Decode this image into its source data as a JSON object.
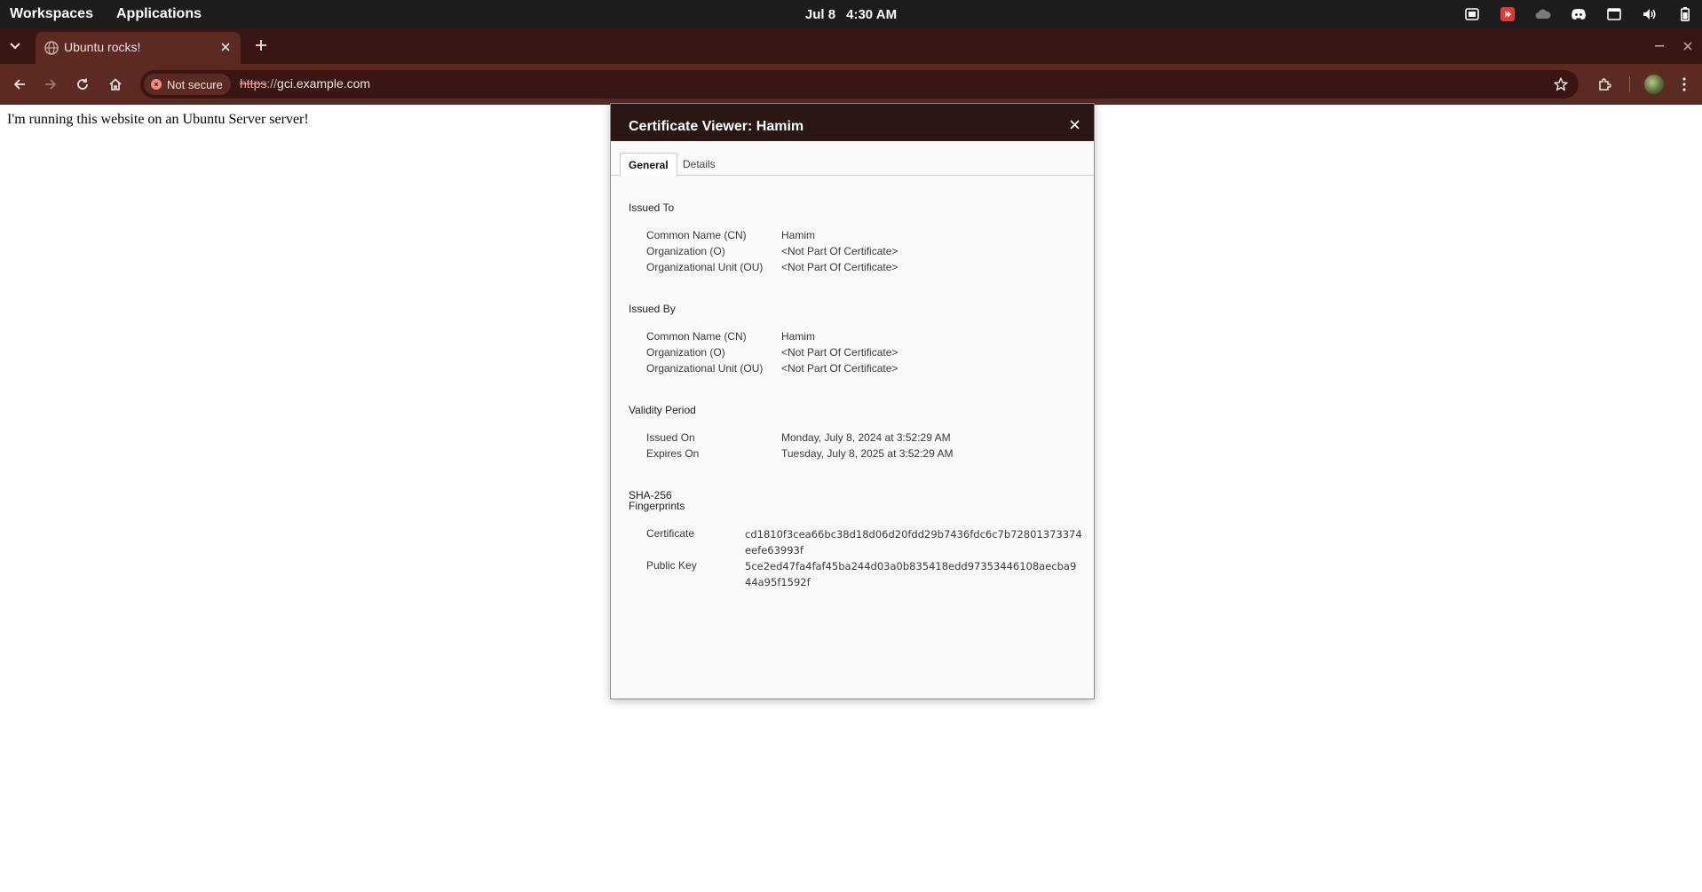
{
  "system_bar": {
    "workspaces": "Workspaces",
    "applications": "Applications",
    "date": "Jul 8",
    "time": "4:30 AM"
  },
  "browser": {
    "tab_title": "Ubuntu rocks!",
    "security_chip": "Not secure",
    "url_scheme": "https",
    "url_separator": "://",
    "url_host": "gci.example.com"
  },
  "page": {
    "text": "I'm running this website on an Ubuntu Server server!"
  },
  "dialog": {
    "title": "Certificate Viewer: Hamim",
    "tabs": [
      "General",
      "Details"
    ],
    "issued_to": {
      "heading": "Issued To",
      "rows": [
        {
          "label": "Common Name (CN)",
          "value": "Hamim"
        },
        {
          "label": "Organization (O)",
          "value": "<Not Part Of Certificate>"
        },
        {
          "label": "Organizational Unit (OU)",
          "value": "<Not Part Of Certificate>"
        }
      ]
    },
    "issued_by": {
      "heading": "Issued By",
      "rows": [
        {
          "label": "Common Name (CN)",
          "value": "Hamim"
        },
        {
          "label": "Organization (O)",
          "value": "<Not Part Of Certificate>"
        },
        {
          "label": "Organizational Unit (OU)",
          "value": "<Not Part Of Certificate>"
        }
      ]
    },
    "validity": {
      "heading": "Validity Period",
      "rows": [
        {
          "label": "Issued On",
          "value": "Monday, July 8, 2024 at 3:52:29 AM"
        },
        {
          "label": "Expires On",
          "value": "Tuesday, July 8, 2025 at 3:52:29 AM"
        }
      ]
    },
    "fingerprints": {
      "heading_line1": "SHA-256",
      "heading_line2": "Fingerprints",
      "rows": [
        {
          "label": "Certificate",
          "value": "cd1810f3cea66bc38d18d06d20fdd29b7436fdc6c7b72801373374eefe63993f"
        },
        {
          "label": "Public Key",
          "value": "5ce2ed47fa4faf45ba244d03a0b835418edd97353446108aecba944a95f1592f"
        }
      ]
    }
  },
  "colors": {
    "system_bar": "#1c1c1c",
    "tab_strip": "#3a1612",
    "toolbar": "#5a2a23",
    "dialog_header": "#2a1614"
  }
}
